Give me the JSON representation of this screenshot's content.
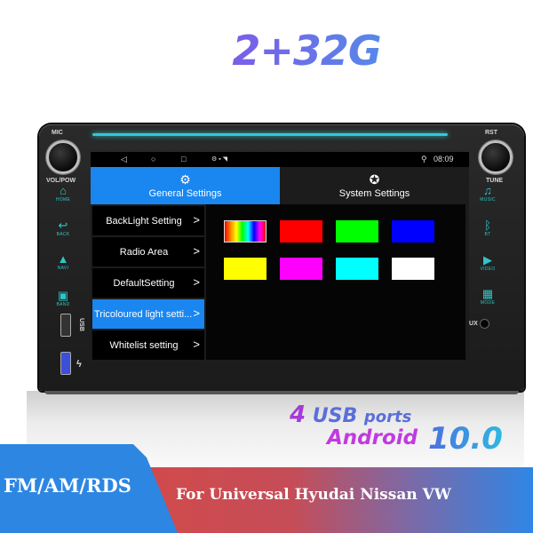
{
  "headline": "2+32G",
  "device": {
    "labels": {
      "mic": "MIC",
      "vol_pow": "VOL/POW",
      "rst": "RST",
      "tune": "TUNE",
      "aux": "AUX",
      "usb": "USB"
    },
    "left_buttons": [
      {
        "icon": "home-icon",
        "glyph": "⌂",
        "label": "HOME"
      },
      {
        "icon": "back-icon",
        "glyph": "↩",
        "label": "BACK"
      },
      {
        "icon": "navi-icon",
        "glyph": "▲",
        "label": "NAVI"
      },
      {
        "icon": "band-icon",
        "glyph": "▣",
        "label": "BAND"
      }
    ],
    "right_buttons": [
      {
        "icon": "music-icon",
        "glyph": "♫",
        "label": "MUSIC"
      },
      {
        "icon": "bluetooth-icon",
        "glyph": "ᛒ",
        "label": "BT"
      },
      {
        "icon": "video-icon",
        "glyph": "▶",
        "label": "VIDEO"
      },
      {
        "icon": "mode-icon",
        "glyph": "▦",
        "label": "MODE"
      }
    ],
    "lightbar_color": "#31c9d6",
    "button_color": "#2ec6c6"
  },
  "screen": {
    "statusbar": {
      "back": "◁",
      "home": "○",
      "recents": "□",
      "notif": "⚙ ▪ ◥",
      "location": "⚲",
      "time": "08:09"
    },
    "tabs": [
      {
        "label": "General Settings",
        "icon": "⚙",
        "active": true
      },
      {
        "label": "System Settings",
        "icon": "✪",
        "active": false
      }
    ],
    "menu": [
      {
        "label": "BackLight Setting",
        "selected": false
      },
      {
        "label": "Radio Area",
        "selected": false
      },
      {
        "label": "DefaultSetting",
        "selected": false
      },
      {
        "label": "Tricoloured light setti...",
        "selected": true
      },
      {
        "label": "Whitelist setting",
        "selected": false
      }
    ],
    "chevron": ">",
    "colors": [
      "rainbow",
      "#ff0000",
      "#00ff00",
      "#0000ff",
      "#ffff00",
      "#ff00ff",
      "#00ffff",
      "#ffffff"
    ],
    "accent": "#1a86f0"
  },
  "features": {
    "usb_count": "4",
    "usb_label": "USB",
    "usb_suffix": "ports",
    "android_label": "Android",
    "android_version": "10.0"
  },
  "banner": {
    "left": "FM/AM/RDS",
    "right": "For Universal Hyudai Nissan VW"
  }
}
